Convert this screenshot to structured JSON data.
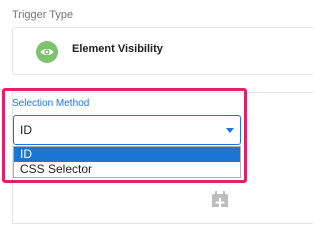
{
  "trigger_type": {
    "label": "Trigger Type",
    "name": "Element Visibility",
    "icon": "eye-icon",
    "badge_color": "#7cc36e"
  },
  "selection_method": {
    "label": "Selection Method",
    "value": "ID",
    "options": [
      "ID",
      "CSS Selector"
    ],
    "highlight_color": "#e5206a",
    "accent_color": "#1a73e8"
  },
  "icons": {
    "calendar": "calendar-add-icon"
  }
}
